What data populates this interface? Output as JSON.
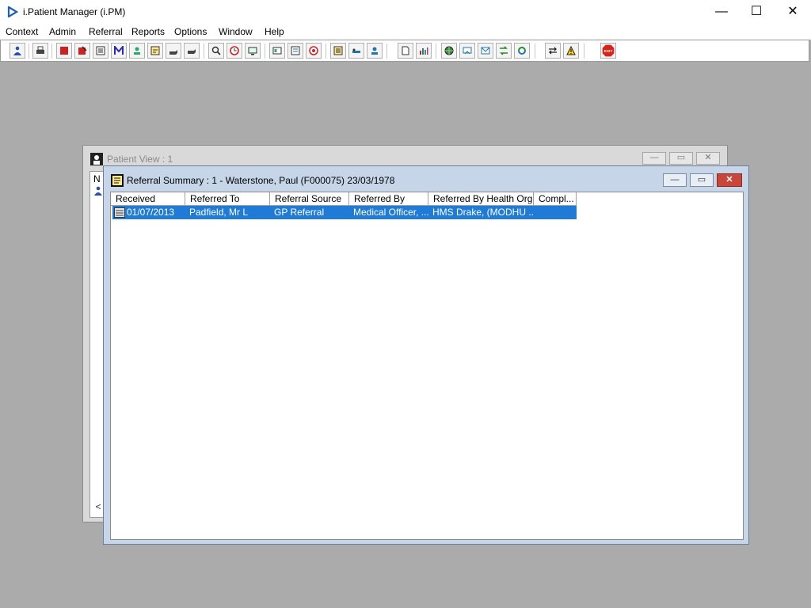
{
  "app": {
    "title": "i.Patient Manager (i.PM)"
  },
  "window_controls": {
    "minimize": "—",
    "maximize": "☐",
    "close": "✕"
  },
  "menu": {
    "items": [
      "Context",
      "Admin",
      "Referral",
      "Reports",
      "Options",
      "Window",
      "Help"
    ]
  },
  "toolbar": {
    "buttons": [
      {
        "icon": "patient-icon"
      },
      {
        "icon": "printer-icon"
      },
      {
        "icon": "book-icon"
      },
      {
        "icon": "edit-book-icon"
      },
      {
        "icon": "document-icon"
      },
      {
        "icon": "mail-icon"
      },
      {
        "icon": "person-icon"
      },
      {
        "icon": "notes-icon"
      },
      {
        "icon": "hand-icon"
      },
      {
        "icon": "hand2-icon"
      },
      {
        "icon": "search-icon"
      },
      {
        "icon": "clock-icon"
      },
      {
        "icon": "monitor-icon"
      },
      {
        "icon": "card-icon"
      },
      {
        "icon": "form-icon"
      },
      {
        "icon": "target-icon"
      },
      {
        "icon": "list-icon"
      },
      {
        "icon": "bed-icon"
      },
      {
        "icon": "nurse-icon"
      },
      {
        "icon": "page-icon"
      },
      {
        "icon": "chart-icon"
      },
      {
        "icon": "globe-icon"
      },
      {
        "icon": "mailbox-icon"
      },
      {
        "icon": "envelope-icon"
      },
      {
        "icon": "transfer-icon"
      },
      {
        "icon": "recycle-icon"
      },
      {
        "icon": "swap-icon"
      },
      {
        "icon": "warning-icon"
      },
      {
        "icon": "exit-icon"
      }
    ],
    "exit_label": "EXIT"
  },
  "patient_view": {
    "title": "Patient View : 1",
    "column_head": "N",
    "controls": {
      "minimize": "—",
      "restore": "▭",
      "close": "✕"
    },
    "scroll_left": "<"
  },
  "referral_summary": {
    "title": "Referral Summary : 1 - Waterstone, Paul (F000075) 23/03/1978",
    "controls": {
      "minimize": "—",
      "restore": "▭",
      "close": "✕"
    },
    "columns": [
      "Received",
      "Referred To",
      "Referral Source",
      "Referred By",
      "Referred By Health Org.",
      "Compl..."
    ],
    "rows": [
      {
        "received": "01/07/2013",
        "referred_to": "Padfield, Mr L",
        "referral_source": "GP Referral",
        "referred_by": "Medical Officer, ...",
        "referred_by_health_org": "HMS Drake, (MODHU ...",
        "completed": ""
      }
    ]
  },
  "colors": {
    "desktop": "#ababab",
    "selection": "#1f7bd6",
    "mdi_active_frame": "#c6d6e8",
    "exit": "#d8231b"
  }
}
